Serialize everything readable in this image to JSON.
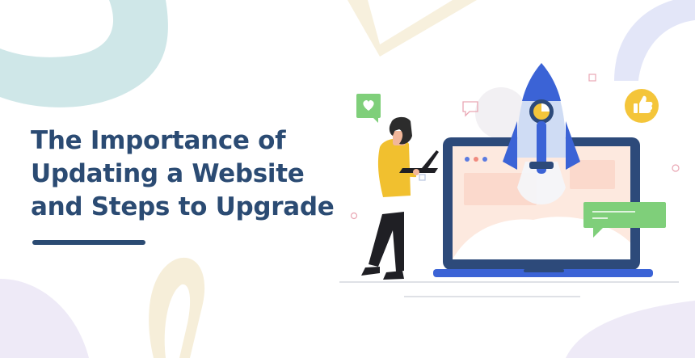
{
  "hero": {
    "title_lines": [
      "The Importance of",
      "Updating a Website",
      "and Steps to Upgrade"
    ]
  },
  "colors": {
    "title": "#2b4b73",
    "rocket_blue": "#3b63d6",
    "laptop_navy": "#2d4a7a",
    "screen_bg": "#fde9df",
    "chat_green": "#7fcf7a",
    "like_yellow": "#f4c53a",
    "person_shirt": "#f1c02f",
    "swirl_teal": "#cfe7e8",
    "swirl_beige": "#f6eed9",
    "swirl_lilac": "#ece8f7"
  },
  "icons": [
    "heart-icon",
    "thumbs-up-icon",
    "chat-bubble-icon",
    "rocket-icon",
    "laptop-icon",
    "person-with-laptop"
  ]
}
